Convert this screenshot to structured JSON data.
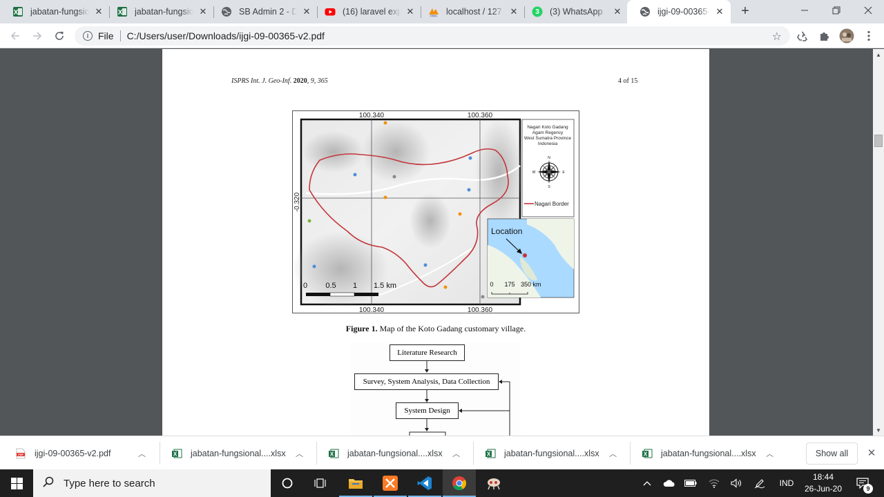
{
  "tabs": [
    {
      "title": "jabatan-fungsional",
      "icon": "excel-icon"
    },
    {
      "title": "jabatan-fungsional",
      "icon": "excel-icon"
    },
    {
      "title": "SB Admin 2 - Dashboard",
      "icon": "globe-icon"
    },
    {
      "title": "(16) laravel export",
      "icon": "youtube-icon"
    },
    {
      "title": "localhost / 127.0.0.1",
      "icon": "phpmyadmin-icon"
    },
    {
      "title": "(3) WhatsApp",
      "icon": "whatsapp-icon"
    },
    {
      "title": "ijgi-09-00365-v2.pdf",
      "icon": "globe-icon"
    }
  ],
  "whatsapp_badge": "3",
  "address_bar": {
    "scheme": "File",
    "url": "C:/Users/user/Downloads/ijgi-09-00365-v2.pdf"
  },
  "pdf": {
    "journal": "ISPRS Int. J. Geo-Inf.",
    "year": "2020",
    "volume_issue": ", 9, 365",
    "page_num": "4 of 15",
    "figure1": {
      "label": "Figure 1.",
      "caption": " Map of the Koto Gadang customary village.",
      "top_lon_left": "100.340",
      "top_lon_right": "100.360",
      "bottom_lon_left": "100.340",
      "bottom_lon_right": "100.360",
      "lat_label": "-0.320",
      "legend_title": [
        "Nagari Koto Gadang",
        "Agam Regency",
        "West Sumatra Province",
        "Indonesia"
      ],
      "compass": {
        "n": "N",
        "s": "S",
        "e": "E",
        "w": "W"
      },
      "legend_border": "Nagari Border",
      "inset_title": "Location",
      "scale_main": [
        "0",
        "0.5",
        "1",
        "1.5 km"
      ],
      "scale_inset": [
        "0",
        "175",
        "350 km"
      ]
    },
    "flow": {
      "step1": "Literature Research",
      "step2": "Survey, System Analysis, Data Collection",
      "step3": "System Design"
    }
  },
  "downloads": [
    {
      "name": "ijgi-09-00365-v2.pdf",
      "icon": "pdf-file-icon"
    },
    {
      "name": "jabatan-fungsional....xlsx",
      "icon": "excel-icon"
    },
    {
      "name": "jabatan-fungsional....xlsx",
      "icon": "excel-icon"
    },
    {
      "name": "jabatan-fungsional....xlsx",
      "icon": "excel-icon"
    },
    {
      "name": "jabatan-fungsional....xlsx",
      "icon": "excel-icon"
    }
  ],
  "show_all": "Show all",
  "taskbar": {
    "search_placeholder": "Type here to search",
    "lang": "IND",
    "time": "18:44",
    "date": "26-Jun-20",
    "notif_count": "9"
  },
  "colors": {
    "nagari_border": "#c4343a",
    "excel_green": "#1e7145",
    "accent_blue": "#1a73e8"
  }
}
